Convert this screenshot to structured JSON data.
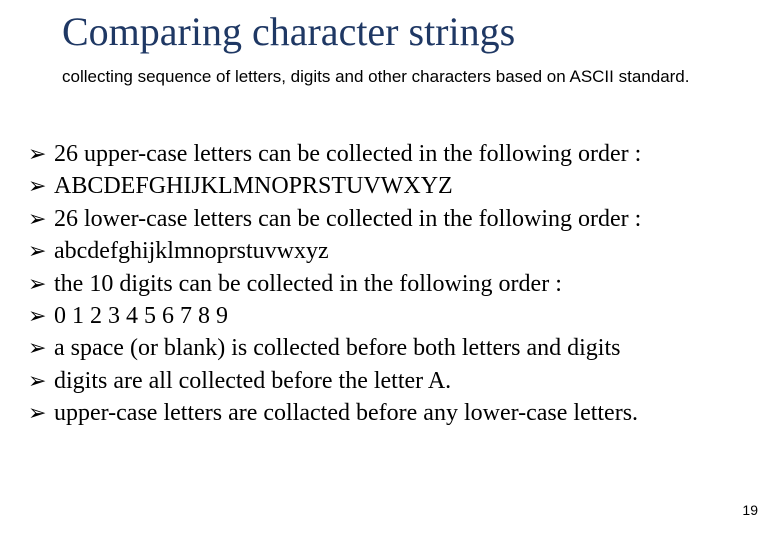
{
  "title": "Comparing character strings",
  "subdesc": "collecting sequence of letters, digits and other characters based on ASCII standard.",
  "items": [
    "26 upper-case letters can be collected in the following order :",
    " ABCDEFGHIJKLMNOPRSTUVWXYZ",
    "26 lower-case letters can be collected in the following order :",
    " abcdefghijklmnoprstuvwxyz",
    " the 10 digits can be collected in the following order :",
    "  0 1 2 3 4 5 6 7 8 9",
    " a space (or blank) is collected before both letters and digits",
    " digits are all collected before the letter  A.",
    "upper-case letters are collacted before any lower-case letters."
  ],
  "bullet_glyph": "➢",
  "page_number": "19"
}
